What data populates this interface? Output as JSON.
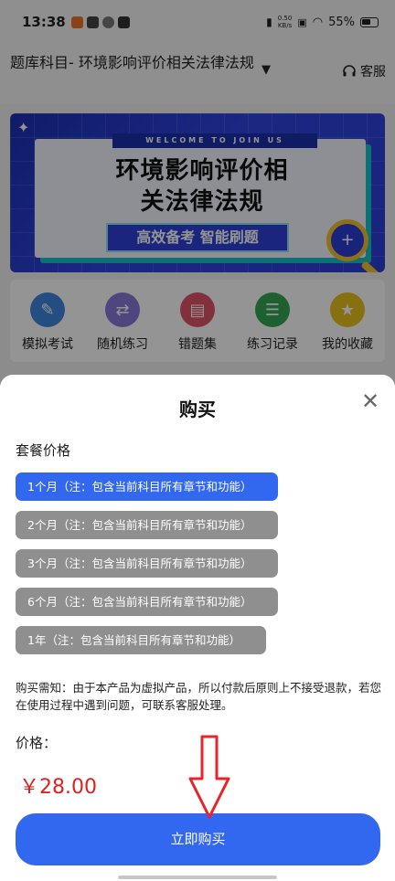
{
  "status_bar": {
    "time": "13:38",
    "net_speed_value": "0.50",
    "net_speed_unit": "KB/s",
    "battery": "55%"
  },
  "header": {
    "title": "题库科目- 环境影响评价相关法律法规",
    "caret_icon": "triangle-down-icon",
    "service_label": "客服",
    "service_icon": "headset-icon"
  },
  "banner": {
    "welcome": "WELCOME TO JOIN US",
    "headline_line1": "环境影响评价相",
    "headline_line2": "关法律法规",
    "tagline": "高效备考 智能刷题",
    "colors": {
      "background": "#2a3fd6",
      "accent": "#16c2c8",
      "highlight": "#f2c230"
    }
  },
  "quick_nav": [
    {
      "label": "模拟考试",
      "icon": "exam-edit-icon",
      "color": "#3f86df"
    },
    {
      "label": "随机练习",
      "icon": "shuffle-icon",
      "color": "#8b79d9"
    },
    {
      "label": "错题集",
      "icon": "error-book-icon",
      "color": "#e2536a"
    },
    {
      "label": "练习记录",
      "icon": "record-list-icon",
      "color": "#35a853"
    },
    {
      "label": "我的收藏",
      "icon": "star-icon",
      "color": "#e7c21c"
    }
  ],
  "sheet": {
    "title": "购买",
    "close_icon": "close-icon",
    "section_label": "套餐价格",
    "plans": [
      {
        "label": "1个月（注：包含当前科目所有章节和功能）",
        "selected": true
      },
      {
        "label": "2个月（注：包含当前科目所有章节和功能）",
        "selected": false
      },
      {
        "label": "3个月（注：包含当前科目所有章节和功能）",
        "selected": false
      },
      {
        "label": "6个月（注：包含当前科目所有章节和功能）",
        "selected": false
      },
      {
        "label": "1年（注：包含当前科目所有章节和功能）",
        "selected": false
      }
    ],
    "notice": "购买需知：由于本产品为虚拟产品，所以付款后原则上不接受退款，若您在使用过程中遇到问题，可联系客服处理。",
    "price_label": "价格：",
    "price": "￥28.00",
    "buy_button": "立即购买",
    "colors": {
      "primary": "#3168ef",
      "unselected": "#8f8f8f",
      "price": "#e0201e"
    }
  }
}
